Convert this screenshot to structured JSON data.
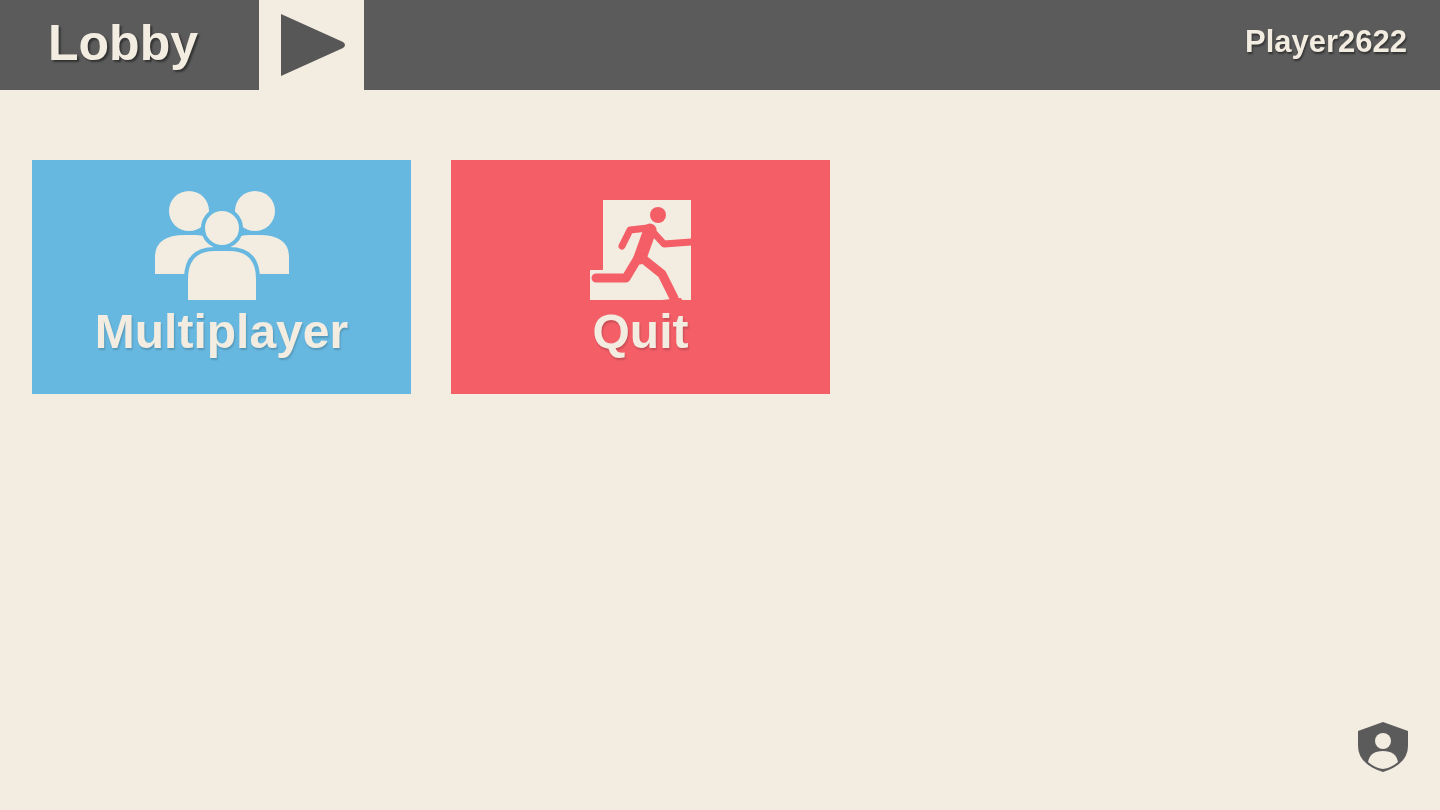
{
  "header": {
    "title": "Lobby",
    "player_name": "Player2622"
  },
  "tiles": [
    {
      "kind": "multiplayer",
      "label": "Multiplayer",
      "color": "#67b8e0"
    },
    {
      "kind": "quit",
      "label": "Quit",
      "color": "#f35e67"
    }
  ]
}
